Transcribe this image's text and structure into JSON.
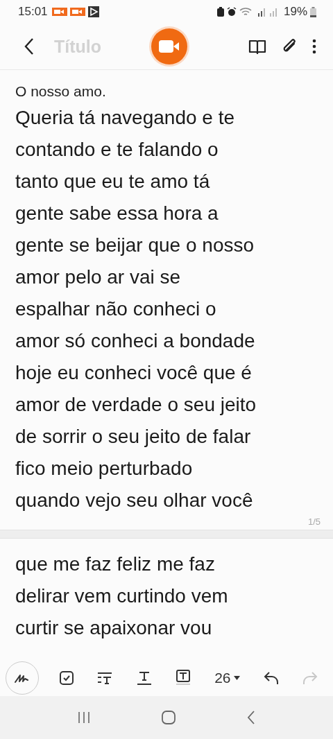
{
  "status_bar": {
    "time": "15:01",
    "battery": "19%"
  },
  "title_field": {
    "placeholder": "Título"
  },
  "pages": [
    {
      "heading": "O nosso amo.",
      "lines": [
        "Queria tá navegando e te",
        "contando e te falando o",
        "tanto que eu te amo tá",
        "gente sabe essa hora a",
        "gente se beijar que o nosso",
        "amor pelo ar vai se",
        "espalhar não conheci o",
        "amor só conheci a bondade",
        "hoje eu conheci você que é",
        "amor de verdade o seu jeito",
        "de sorrir o seu jeito de falar",
        "fico meio perturbado",
        "quando vejo seu olhar você"
      ],
      "page_number": "1/5"
    },
    {
      "lines": [
        "que me faz feliz me faz",
        "delirar vem curtindo vem",
        "curtir se apaixonar vou"
      ]
    }
  ],
  "toolbar": {
    "font_size": "26",
    "redo_disabled": true
  }
}
